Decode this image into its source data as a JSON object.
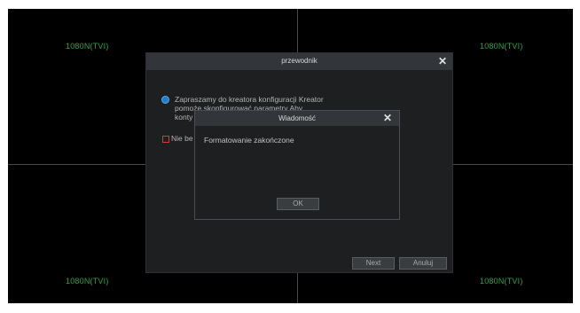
{
  "channels": {
    "top_left": "1080N(TVI)",
    "top_right": "1080N(TVI)",
    "bottom_left": "1080N(TVI)",
    "bottom_right": "1080N(TVI)"
  },
  "wizard": {
    "title": "przewodnik",
    "intro_lines": [
      "Zapraszamy do kreatora konfiguracji Kreator",
      "pomoże skonfigurować parametry Aby",
      "konty"
    ],
    "dont_show_label": "Nie be",
    "next_label": "Next",
    "cancel_label": "Anuluj"
  },
  "message": {
    "title": "Wiadomość",
    "text": "Formatowanie zakończone",
    "ok_label": "OK"
  },
  "colors": {
    "channel_label": "#2fa34a",
    "radio_selected": "#1e7fd0",
    "checkbox_border": "#d23a3a"
  },
  "icons": {
    "close": "close-icon"
  }
}
